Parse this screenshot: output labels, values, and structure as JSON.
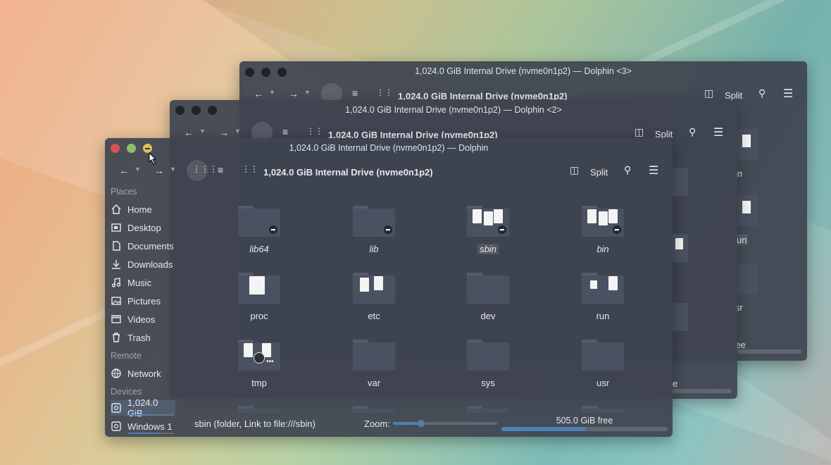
{
  "windows": {
    "back": {
      "title": "1,024.0 GiB Internal Drive (nvme0n1p2) — Dolphin <3>",
      "path": "1,024.0 GiB Internal Drive (nvme0n1p2)",
      "split": "Split"
    },
    "middle": {
      "title": "1,024.0 GiB Internal Drive (nvme0n1p2) — Dolphin <2>",
      "path": "1,024.0 GiB Internal Drive (nvme0n1p2)",
      "split": "Split"
    },
    "front": {
      "title": "1,024.0 GiB Internal Drive (nvme0n1p2) — Dolphin",
      "path": "1,024.0 GiB Internal Drive (nvme0n1p2)",
      "split": "Split"
    }
  },
  "sidebar": {
    "places_heading": "Places",
    "places": [
      {
        "label": "Home",
        "icon": "home-icon"
      },
      {
        "label": "Desktop",
        "icon": "desktop-icon"
      },
      {
        "label": "Documents",
        "icon": "documents-icon"
      },
      {
        "label": "Downloads",
        "icon": "downloads-icon"
      },
      {
        "label": "Music",
        "icon": "music-icon"
      },
      {
        "label": "Pictures",
        "icon": "pictures-icon"
      },
      {
        "label": "Videos",
        "icon": "videos-icon"
      },
      {
        "label": "Trash",
        "icon": "trash-icon"
      }
    ],
    "remote_heading": "Remote",
    "remote": [
      {
        "label": "Network",
        "icon": "network-icon"
      }
    ],
    "devices_heading": "Devices",
    "devices": [
      {
        "label": "1,024.0 GiB",
        "icon": "drive-icon",
        "usage": 0.5
      },
      {
        "label": "Windows 1",
        "icon": "drive-icon",
        "usage": 0.7
      }
    ]
  },
  "folders": [
    {
      "name": "lib64"
    },
    {
      "name": "lib"
    },
    {
      "name": "sbin"
    },
    {
      "name": "bin"
    },
    {
      "name": "proc"
    },
    {
      "name": "etc"
    },
    {
      "name": "dev"
    },
    {
      "name": "run"
    },
    {
      "name": "tmp"
    },
    {
      "name": "var"
    },
    {
      "name": "sys"
    },
    {
      "name": "usr"
    }
  ],
  "back_partial_labels": [
    "in",
    "un",
    "sr",
    "ree"
  ],
  "middle_partial_labels": [
    "e"
  ],
  "status": {
    "selection": "sbin (folder, Link to file:///sbin)",
    "zoom_label": "Zoom:",
    "zoom_level": 0.27,
    "free": "505.0 GiB free",
    "used_fraction": 0.51
  },
  "colors": {
    "accent": "#4f7fb4",
    "close": "#d9534f",
    "maximize": "#8fbf6a",
    "minimize": "#e0c060"
  }
}
